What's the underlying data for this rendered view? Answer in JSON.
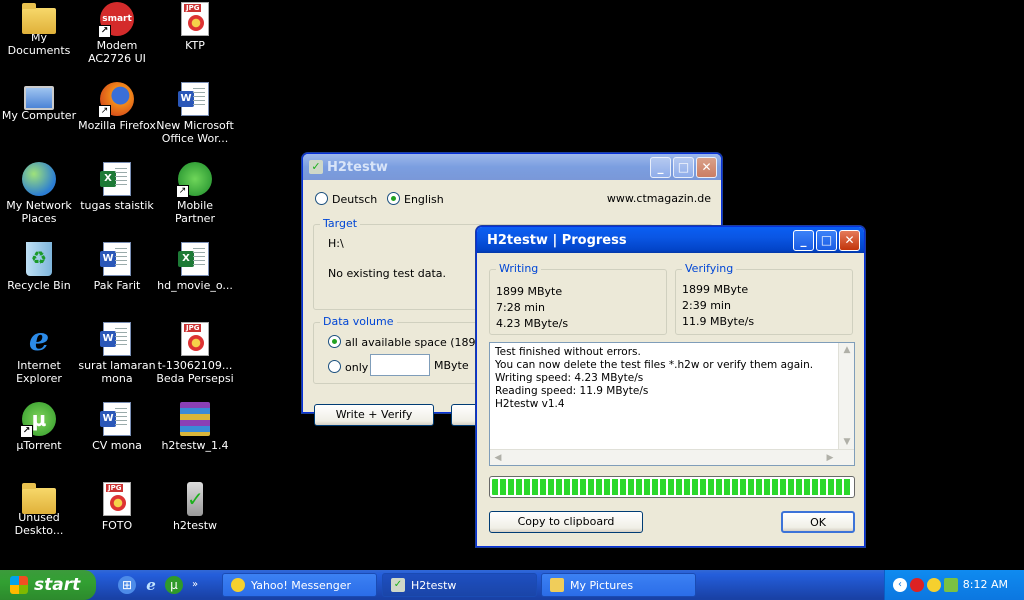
{
  "desktop": {
    "icons": [
      {
        "label": "My Documents"
      },
      {
        "label": "Modem AC2726 UI"
      },
      {
        "label": "KTP"
      },
      {
        "label": "My Computer"
      },
      {
        "label": "Mozilla Firefox"
      },
      {
        "label": "New Microsoft Office Wor..."
      },
      {
        "label": "My Network Places"
      },
      {
        "label": "tugas staistik"
      },
      {
        "label": "Mobile Partner"
      },
      {
        "label": "Recycle Bin"
      },
      {
        "label": "Pak Farit"
      },
      {
        "label": "hd_movie_o..."
      },
      {
        "label": "Internet Explorer"
      },
      {
        "label": "surat lamaran mona"
      },
      {
        "label": "t-13062109... Beda Persepsi"
      },
      {
        "label": "µTorrent"
      },
      {
        "label": "CV mona"
      },
      {
        "label": "h2testw_1.4"
      },
      {
        "label": "Unused Deskto..."
      },
      {
        "label": "FOTO"
      },
      {
        "label": "h2testw"
      }
    ],
    "modem_badge": "smart",
    "jpg_tag": "JPG"
  },
  "main_window": {
    "title": "H2testw",
    "lang_deutsch": "Deutsch",
    "lang_english": "English",
    "website": "www.ctmagazin.de",
    "target_group": "Target",
    "target_path": "H:\\",
    "target_status": "No existing test data.",
    "volume_group": "Data volume",
    "all_space": "all available space (1899 MB",
    "only": "only",
    "only_value": "",
    "unit": "MByte",
    "write_verify": "Write + Verify"
  },
  "progress_window": {
    "title": "H2testw | Progress",
    "writing": {
      "label": "Writing",
      "size": "1899 MByte",
      "time": "7:28 min",
      "speed": "4.23 MByte/s"
    },
    "verifying": {
      "label": "Verifying",
      "size": "1899 MByte",
      "time": "2:39 min",
      "speed": "11.9 MByte/s"
    },
    "log": [
      "Test finished without errors.",
      "You can now delete the test files *.h2w or verify them again.",
      "Writing speed: 4.23 MByte/s",
      "Reading speed: 11.9 MByte/s",
      "H2testw v1.4"
    ],
    "progress_fraction": 1.0,
    "copy_button": "Copy to clipboard",
    "ok_button": "OK"
  },
  "taskbar": {
    "start": "start",
    "tasks": [
      {
        "label": "Yahoo! Messenger"
      },
      {
        "label": "H2testw"
      },
      {
        "label": "My Pictures"
      }
    ],
    "clock": "8:12 AM"
  }
}
